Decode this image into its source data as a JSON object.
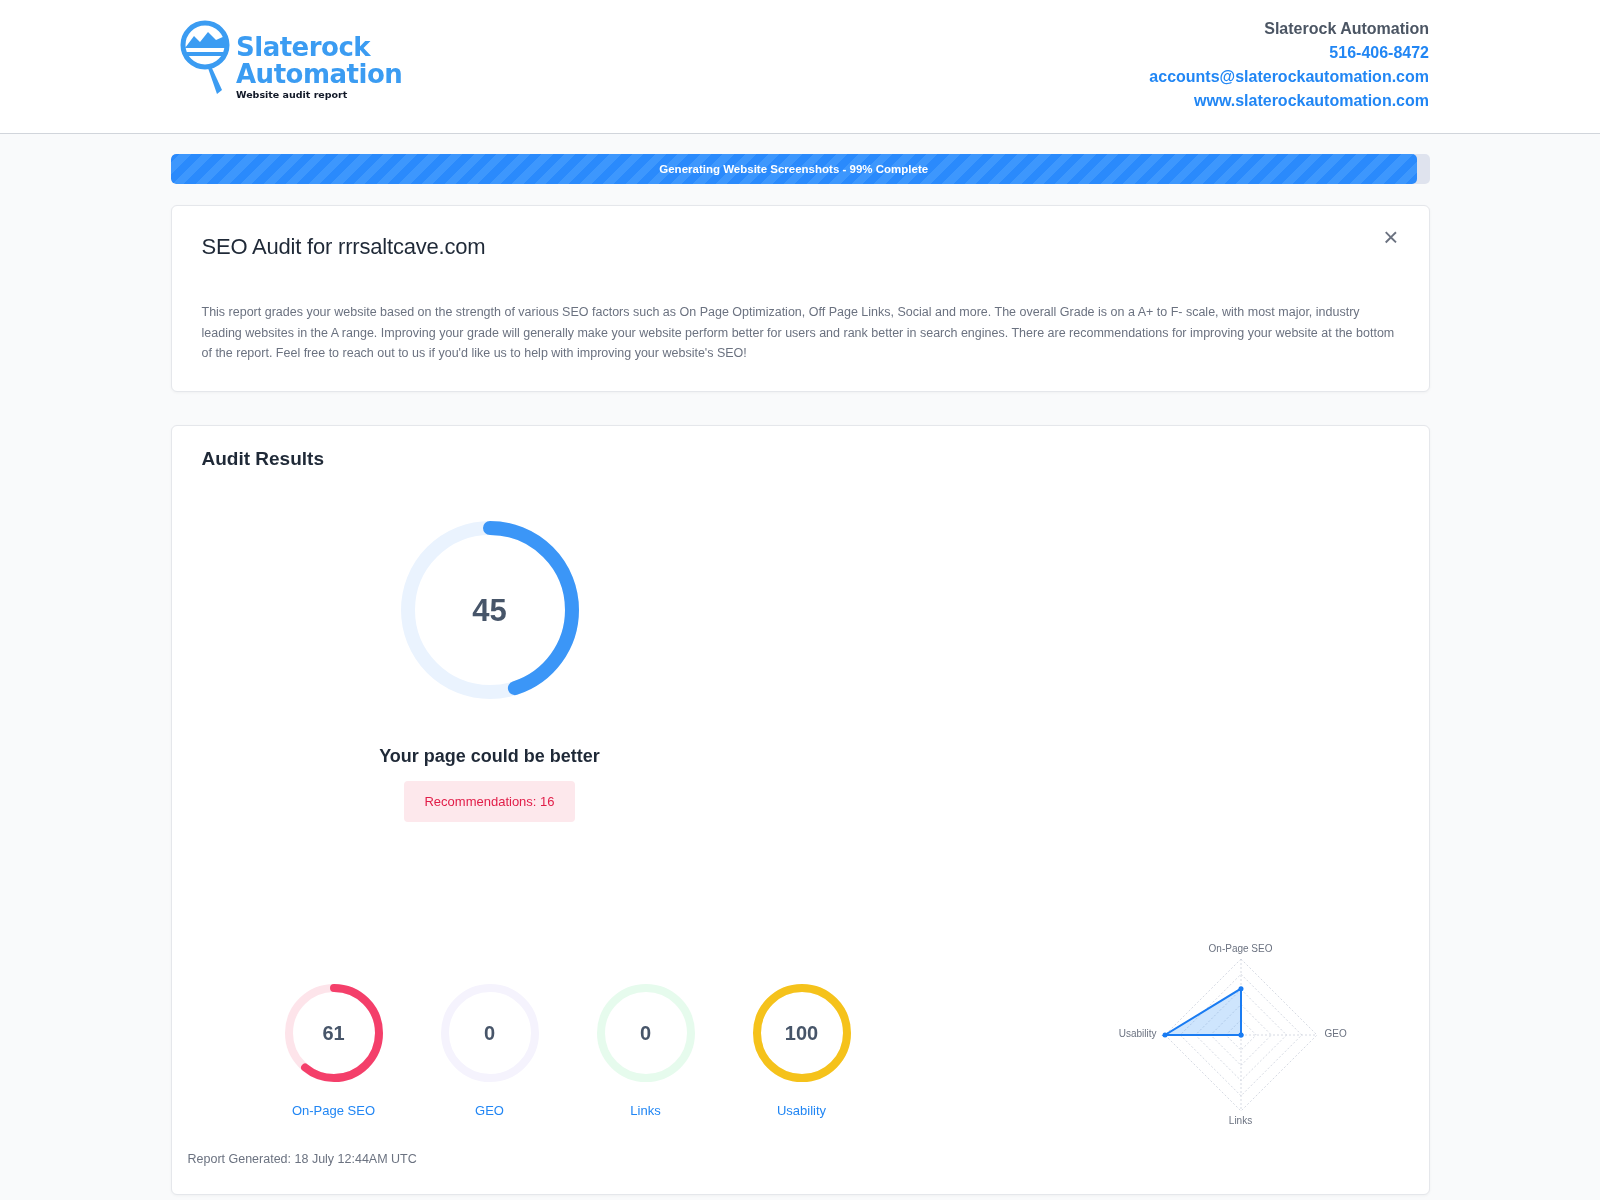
{
  "logo": {
    "line_1": "Slaterock",
    "line_2": "Automation",
    "tagline": "Website audit report"
  },
  "contact": {
    "company": "Slaterock Automation",
    "phone": "516-406-8472",
    "email": "accounts@slaterockautomation.com",
    "website": "www.slaterockautomation.com"
  },
  "progress": {
    "label": "Generating Website Screenshots - 99% Complete",
    "level": 0.99
  },
  "intro": {
    "title": "SEO Audit for rrrsaltcave.com",
    "close": "×",
    "text": "This report grades your website based on the strength of various SEO factors such as On Page Optimization, Off Page Links, Social and more. The overall Grade is on a A+ to F- scale, with most major, industry leading websites in the A range. Improving your grade will generally make your website perform better for users and rank better in search engines. There are recommendations for improving your website at the bottom of the report. Feel free to reach out to us if you'd like us to help with improving your website's SEO!"
  },
  "results": {
    "title": "Audit Results",
    "score": "45",
    "verdict": "Your page could be better",
    "recommendations": "Recommendations: 16",
    "categories": [
      {
        "score": "61",
        "label": "On-Page SEO",
        "color": "#f43f6a"
      },
      {
        "score": "0",
        "label": "GEO",
        "color": "#f5f3fd"
      },
      {
        "score": "0",
        "label": "Links",
        "color": "#e6fbed"
      },
      {
        "score": "100",
        "label": "Usability",
        "color": "#f5c21b"
      }
    ],
    "radar_labels": [
      "On-Page SEO",
      "GEO",
      "Links",
      "Usability"
    ],
    "generated": "Report Generated: 18 July 12:44AM UTC"
  }
}
